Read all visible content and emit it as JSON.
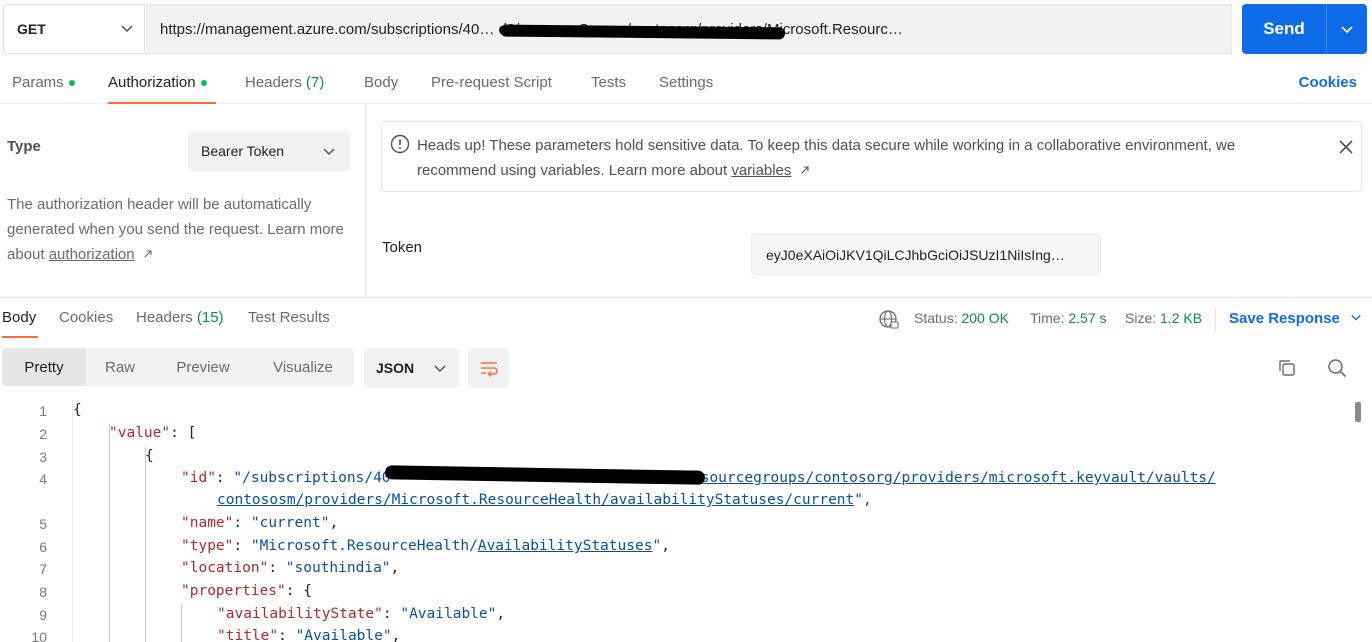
{
  "request": {
    "method": "GET",
    "url": "https://management.azure.com/subscriptions/40…                                         d8/resourceGroups/contosorg/providers/Microsoft.Resourc…",
    "send_label": "Send"
  },
  "request_tabs": [
    {
      "label": "Params",
      "dot": true
    },
    {
      "label": "Authorization",
      "dot": true,
      "active": true
    },
    {
      "label": "Headers",
      "count": "(7)"
    },
    {
      "label": "Body"
    },
    {
      "label": "Pre-request Script"
    },
    {
      "label": "Tests"
    },
    {
      "label": "Settings"
    }
  ],
  "cookies_link": "Cookies",
  "auth": {
    "type_label": "Type",
    "type_value": "Bearer Token",
    "desc_prefix": "The authorization header will be automatically generated when you send the request. Learn more about ",
    "desc_link": "authorization",
    "notice_prefix": "Heads up! These parameters hold sensitive data. To keep this data secure while working in a collaborative environment, we recommend using variables. Learn more about ",
    "notice_link": "variables",
    "token_label": "Token",
    "token_value": "eyJ0eXAiOiJKV1QiLCJhbGciOiJSUzI1NiIsIng…"
  },
  "response_tabs": [
    {
      "label": "Body",
      "active": true
    },
    {
      "label": "Cookies"
    },
    {
      "label": "Headers",
      "count": "(15)"
    },
    {
      "label": "Test Results"
    }
  ],
  "status": {
    "status_label": "Status:",
    "status_value": "200 OK",
    "time_label": "Time:",
    "time_value": "2.57 s",
    "size_label": "Size:",
    "size_value": "1.2 KB",
    "save_response": "Save Response"
  },
  "view_modes": [
    "Pretty",
    "Raw",
    "Preview",
    "Visualize"
  ],
  "format": "JSON",
  "code": {
    "line_numbers": [
      "1",
      "2",
      "3",
      "4",
      "5",
      "6",
      "7",
      "8",
      "9",
      "10"
    ],
    "l1": "{",
    "l2_key": "\"value\"",
    "l2_rest": ": [",
    "l3": "{",
    "l4_key": "\"id\"",
    "l4_colon": ": ",
    "l4_val_a": "\"/subscriptions/40",
    "l4_val_b": "/resourcegroups/contosorg/providers/microsoft.keyvault/vaults/",
    "l4_val_c": "contososm/providers/Microsoft.ResourceHealth/availabilityStatuses/current",
    "l4_end": "\",",
    "l5_key": "\"name\"",
    "l5_val": "\"current\"",
    "l6_key": "\"type\"",
    "l6_val_a": "\"Microsoft.ResourceHealth/",
    "l6_val_b": "AvailabilityStatuses",
    "l6_val_c": "\"",
    "l7_key": "\"location\"",
    "l7_val": "\"southindia\"",
    "l8_key": "\"properties\"",
    "l8_rest": ": {",
    "l9_key": "\"availabilityState\"",
    "l9_val": "\"Available\"",
    "l10_key": "\"title\"",
    "l10_val": "\"Available\""
  }
}
